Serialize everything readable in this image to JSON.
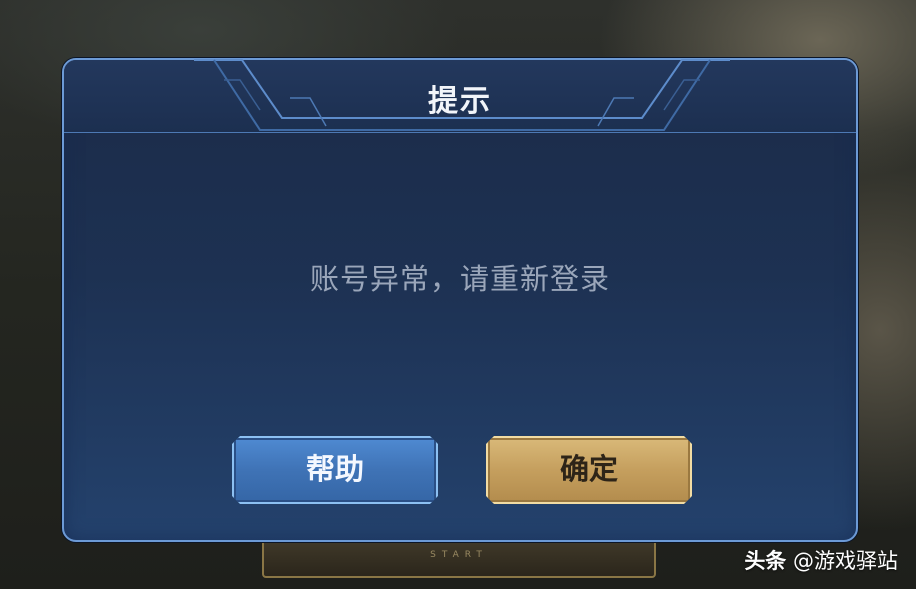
{
  "dialog": {
    "title": "提示",
    "message": "账号异常，请重新登录",
    "buttons": {
      "help_label": "帮助",
      "confirm_label": "确定"
    }
  },
  "background": {
    "start_text": "START"
  },
  "watermark": {
    "brand": "头条",
    "handle": "@游戏驿站"
  },
  "colors": {
    "dialog_border": "#6c9ad6",
    "dialog_bg": "#1d3152",
    "help_button": "#3f73b6",
    "confirm_button": "#c59f5e",
    "message_text": "#9aa6ba"
  }
}
